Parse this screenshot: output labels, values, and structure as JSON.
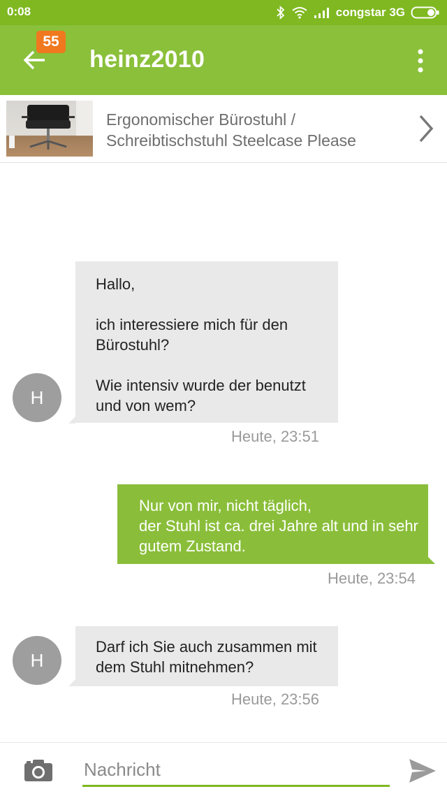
{
  "status_bar": {
    "time": "0:08",
    "carrier": "congstar 3G",
    "icons": [
      "bluetooth-icon",
      "wifi-icon",
      "signal-icon",
      "battery-icon"
    ]
  },
  "header": {
    "unread_count": "55",
    "title": "heinz2010",
    "colors": {
      "accent": "#8ac03a",
      "badge": "#f0781e"
    }
  },
  "listing": {
    "title_line1": "Ergonomischer Bürostuhl /",
    "title_line2": "Schreibtischstuhl Steelcase Please"
  },
  "messages": [
    {
      "direction": "incoming",
      "avatar": "H",
      "text": "Hallo,\n\nich interessiere mich für den Bürostuhl?\n\nWie intensiv wurde der benutzt und von wem?",
      "time": "Heute, 23:51"
    },
    {
      "direction": "outgoing",
      "text": "Nur von mir, nicht täglich,\nder Stuhl ist ca. drei Jahre alt und in sehr gutem Zustand.",
      "time": "Heute, 23:54"
    },
    {
      "direction": "incoming",
      "avatar": "H",
      "text": "Darf ich Sie auch zusammen mit dem Stuhl mitnehmen?",
      "time": "Heute, 23:56"
    }
  ],
  "composer": {
    "placeholder": "Nachricht",
    "value": ""
  }
}
